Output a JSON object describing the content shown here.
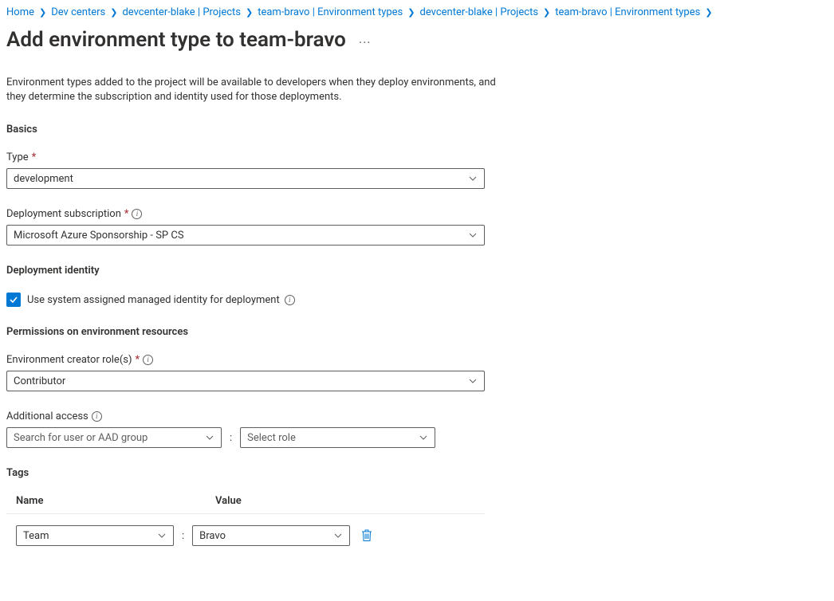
{
  "breadcrumb": [
    {
      "label": "Home"
    },
    {
      "label": "Dev centers"
    },
    {
      "label": "devcenter-blake | Projects"
    },
    {
      "label": "team-bravo | Environment types"
    },
    {
      "label": "devcenter-blake | Projects"
    },
    {
      "label": "team-bravo | Environment types"
    }
  ],
  "page": {
    "title": "Add environment type to team-bravo",
    "description": "Environment types added to the project will be available to developers when they deploy environments, and they determine the subscription and identity used for those deployments."
  },
  "sections": {
    "basics": {
      "heading": "Basics",
      "type_label": "Type",
      "type_value": "development",
      "subscription_label": "Deployment subscription",
      "subscription_value": "Microsoft Azure Sponsorship - SP CS"
    },
    "identity": {
      "heading": "Deployment identity",
      "checkbox_label": "Use system assigned managed identity for deployment"
    },
    "permissions": {
      "heading": "Permissions on environment resources",
      "creator_label": "Environment creator role(s)",
      "creator_value": "Contributor",
      "additional_label": "Additional access",
      "user_placeholder": "Search for user or AAD group",
      "role_placeholder": "Select role"
    },
    "tags": {
      "heading": "Tags",
      "col_name": "Name",
      "col_value": "Value",
      "rows": [
        {
          "name": "Team",
          "value": "Bravo"
        }
      ]
    }
  }
}
